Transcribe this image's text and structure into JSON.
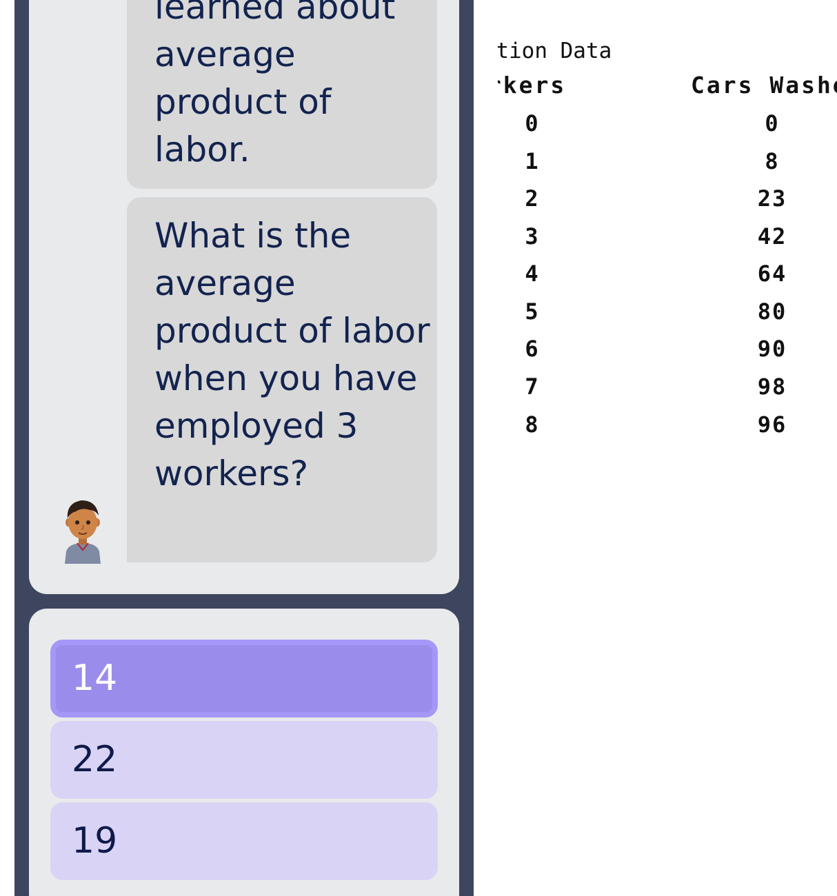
{
  "chat": {
    "messages": [
      {
        "text": "learned about average product of labor."
      },
      {
        "text": "What is the average product of labor when you have employed 3 workers?"
      }
    ]
  },
  "answers": [
    {
      "label": "14",
      "selected": true
    },
    {
      "label": "22",
      "selected": false
    },
    {
      "label": "19",
      "selected": false
    }
  ],
  "table": {
    "title": "uction Data",
    "headers": [
      "orkers",
      "Cars Washe"
    ],
    "rows": [
      [
        "0",
        "0"
      ],
      [
        "1",
        "8"
      ],
      [
        "2",
        "23"
      ],
      [
        "3",
        "42"
      ],
      [
        "4",
        "64"
      ],
      [
        "5",
        "80"
      ],
      [
        "6",
        "90"
      ],
      [
        "7",
        "98"
      ],
      [
        "8",
        "96"
      ]
    ]
  },
  "colors": {
    "sidebar_bg": "#3d465e",
    "card_bg": "#e9eaec",
    "bubble_bg": "#d8d8d8",
    "answer_bg": "#d9d4f5",
    "answer_selected_bg": "#9a8ceb",
    "text_dark": "#13234f"
  }
}
